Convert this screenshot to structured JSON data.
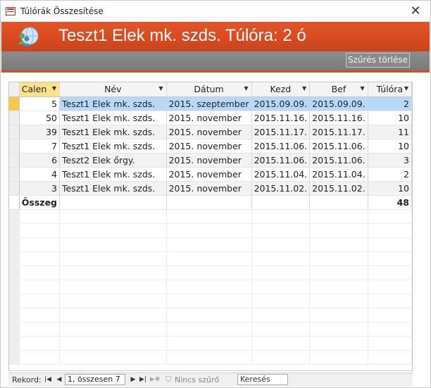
{
  "window": {
    "title": "Túlórák Összesítése",
    "close_glyph": "✕"
  },
  "header": {
    "title": "Teszt1 Elek mk. szds. Túlóra: 2 ó"
  },
  "toolbar": {
    "clear_filter_label": "Szűrés törlése"
  },
  "columns": [
    {
      "label": "Calen"
    },
    {
      "label": "Név"
    },
    {
      "label": "Dátum"
    },
    {
      "label": "Kezd"
    },
    {
      "label": "Bef"
    },
    {
      "label": "Túlóra"
    }
  ],
  "rows": [
    {
      "cal": "5",
      "nev": "Teszt1 Elek mk. szds.",
      "datum": "2015. szeptember",
      "kezd": "2015.09.09.",
      "bef": "2015.09.09.",
      "tulora": "2"
    },
    {
      "cal": "50",
      "nev": "Teszt1 Elek mk. szds.",
      "datum": "2015. november",
      "kezd": "2015.11.16.",
      "bef": "2015.11.16.",
      "tulora": "10"
    },
    {
      "cal": "39",
      "nev": "Teszt1 Elek mk. szds.",
      "datum": "2015. november",
      "kezd": "2015.11.17.",
      "bef": "2015.11.17.",
      "tulora": "11"
    },
    {
      "cal": "7",
      "nev": "Teszt1 Elek mk. szds.",
      "datum": "2015. november",
      "kezd": "2015.11.06.",
      "bef": "2015.11.06.",
      "tulora": "10"
    },
    {
      "cal": "6",
      "nev": "Teszt2 Elek őrgy.",
      "datum": "2015. november",
      "kezd": "2015.11.06.",
      "bef": "2015.11.06.",
      "tulora": "3"
    },
    {
      "cal": "4",
      "nev": "Teszt1 Elek mk. szds.",
      "datum": "2015. november",
      "kezd": "2015.11.04.",
      "bef": "2015.11.04.",
      "tulora": "2"
    },
    {
      "cal": "3",
      "nev": "Teszt1 Elek mk. szds.",
      "datum": "2015. november",
      "kezd": "2015.11.02.",
      "bef": "2015.11.02.",
      "tulora": "10"
    }
  ],
  "total": {
    "label": "Összeg",
    "value": "48"
  },
  "navbar": {
    "record_label": "Rekord:",
    "position": "1, összesen 7",
    "filter_state": "Nincs szűrő",
    "search_placeholder": "Keresés",
    "first_icon": "first-record-icon",
    "prev_icon": "prev-record-icon",
    "next_icon": "next-record-icon",
    "last_icon": "last-record-icon",
    "new_icon": "new-record-icon"
  },
  "colors": {
    "header_orange": "#d84a20",
    "gray_band": "#7f7f7f",
    "selected_row": "#b8d8f8",
    "selected_header": "#fde28a"
  }
}
